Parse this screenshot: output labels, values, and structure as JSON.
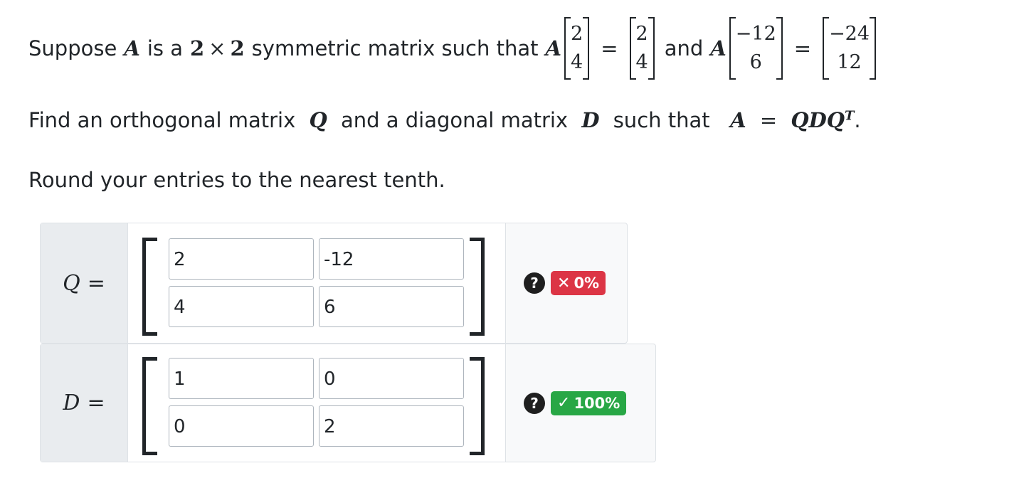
{
  "problem": {
    "l1_suppose": "Suppose",
    "var_A": "A",
    "l1_is_a": "is a",
    "dim_2a": "2",
    "times": "×",
    "dim_2b": "2",
    "l1_symmetric": "symmetric matrix such that",
    "vec1_top": "2",
    "vec1_bot": "4",
    "equals": "=",
    "res1_top": "2",
    "res1_bot": "4",
    "and_text": "and",
    "vec2_top": "−12",
    "vec2_bot": "6",
    "res2_top": "−24",
    "res2_bot": "12",
    "l2_find": "Find an orthogonal matrix",
    "var_Q": "Q",
    "l2_and_diag": "and a diagonal matrix",
    "var_D": "D",
    "l2_such_that": "such that",
    "l2_eq_expr_lhs": "A",
    "l2_eq_expr_rhs": "QDQ",
    "l2_sup_T": "T",
    "l2_period": ".",
    "l3_round": "Round your entries to the nearest tenth."
  },
  "answers": {
    "q": {
      "label_var": "Q",
      "label_eq": "=",
      "cells": [
        "2",
        "-12",
        "4",
        "6"
      ],
      "help_glyph": "?",
      "badge_icon": "✕",
      "badge_text": "0%",
      "badge_color": "#dc3545"
    },
    "d": {
      "label_var": "D",
      "label_eq": "=",
      "cells": [
        "1",
        "0",
        "0",
        "2"
      ],
      "help_glyph": "?",
      "badge_icon": "✓",
      "badge_text": "100%",
      "badge_color": "#28a745"
    }
  }
}
